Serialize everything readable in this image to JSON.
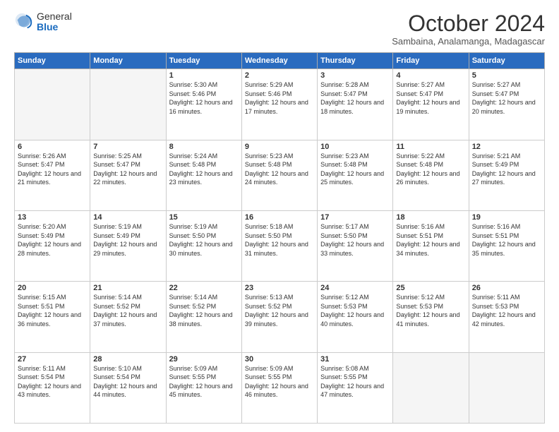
{
  "logo": {
    "general": "General",
    "blue": "Blue"
  },
  "header": {
    "title": "October 2024",
    "subtitle": "Sambaina, Analamanga, Madagascar"
  },
  "weekdays": [
    "Sunday",
    "Monday",
    "Tuesday",
    "Wednesday",
    "Thursday",
    "Friday",
    "Saturday"
  ],
  "days": [
    {
      "day": "",
      "sunrise": "",
      "sunset": "",
      "daylight": ""
    },
    {
      "day": "",
      "sunrise": "",
      "sunset": "",
      "daylight": ""
    },
    {
      "day": "1",
      "sunrise": "Sunrise: 5:30 AM",
      "sunset": "Sunset: 5:46 PM",
      "daylight": "Daylight: 12 hours and 16 minutes."
    },
    {
      "day": "2",
      "sunrise": "Sunrise: 5:29 AM",
      "sunset": "Sunset: 5:46 PM",
      "daylight": "Daylight: 12 hours and 17 minutes."
    },
    {
      "day": "3",
      "sunrise": "Sunrise: 5:28 AM",
      "sunset": "Sunset: 5:47 PM",
      "daylight": "Daylight: 12 hours and 18 minutes."
    },
    {
      "day": "4",
      "sunrise": "Sunrise: 5:27 AM",
      "sunset": "Sunset: 5:47 PM",
      "daylight": "Daylight: 12 hours and 19 minutes."
    },
    {
      "day": "5",
      "sunrise": "Sunrise: 5:27 AM",
      "sunset": "Sunset: 5:47 PM",
      "daylight": "Daylight: 12 hours and 20 minutes."
    },
    {
      "day": "6",
      "sunrise": "Sunrise: 5:26 AM",
      "sunset": "Sunset: 5:47 PM",
      "daylight": "Daylight: 12 hours and 21 minutes."
    },
    {
      "day": "7",
      "sunrise": "Sunrise: 5:25 AM",
      "sunset": "Sunset: 5:47 PM",
      "daylight": "Daylight: 12 hours and 22 minutes."
    },
    {
      "day": "8",
      "sunrise": "Sunrise: 5:24 AM",
      "sunset": "Sunset: 5:48 PM",
      "daylight": "Daylight: 12 hours and 23 minutes."
    },
    {
      "day": "9",
      "sunrise": "Sunrise: 5:23 AM",
      "sunset": "Sunset: 5:48 PM",
      "daylight": "Daylight: 12 hours and 24 minutes."
    },
    {
      "day": "10",
      "sunrise": "Sunrise: 5:23 AM",
      "sunset": "Sunset: 5:48 PM",
      "daylight": "Daylight: 12 hours and 25 minutes."
    },
    {
      "day": "11",
      "sunrise": "Sunrise: 5:22 AM",
      "sunset": "Sunset: 5:48 PM",
      "daylight": "Daylight: 12 hours and 26 minutes."
    },
    {
      "day": "12",
      "sunrise": "Sunrise: 5:21 AM",
      "sunset": "Sunset: 5:49 PM",
      "daylight": "Daylight: 12 hours and 27 minutes."
    },
    {
      "day": "13",
      "sunrise": "Sunrise: 5:20 AM",
      "sunset": "Sunset: 5:49 PM",
      "daylight": "Daylight: 12 hours and 28 minutes."
    },
    {
      "day": "14",
      "sunrise": "Sunrise: 5:19 AM",
      "sunset": "Sunset: 5:49 PM",
      "daylight": "Daylight: 12 hours and 29 minutes."
    },
    {
      "day": "15",
      "sunrise": "Sunrise: 5:19 AM",
      "sunset": "Sunset: 5:50 PM",
      "daylight": "Daylight: 12 hours and 30 minutes."
    },
    {
      "day": "16",
      "sunrise": "Sunrise: 5:18 AM",
      "sunset": "Sunset: 5:50 PM",
      "daylight": "Daylight: 12 hours and 31 minutes."
    },
    {
      "day": "17",
      "sunrise": "Sunrise: 5:17 AM",
      "sunset": "Sunset: 5:50 PM",
      "daylight": "Daylight: 12 hours and 33 minutes."
    },
    {
      "day": "18",
      "sunrise": "Sunrise: 5:16 AM",
      "sunset": "Sunset: 5:51 PM",
      "daylight": "Daylight: 12 hours and 34 minutes."
    },
    {
      "day": "19",
      "sunrise": "Sunrise: 5:16 AM",
      "sunset": "Sunset: 5:51 PM",
      "daylight": "Daylight: 12 hours and 35 minutes."
    },
    {
      "day": "20",
      "sunrise": "Sunrise: 5:15 AM",
      "sunset": "Sunset: 5:51 PM",
      "daylight": "Daylight: 12 hours and 36 minutes."
    },
    {
      "day": "21",
      "sunrise": "Sunrise: 5:14 AM",
      "sunset": "Sunset: 5:52 PM",
      "daylight": "Daylight: 12 hours and 37 minutes."
    },
    {
      "day": "22",
      "sunrise": "Sunrise: 5:14 AM",
      "sunset": "Sunset: 5:52 PM",
      "daylight": "Daylight: 12 hours and 38 minutes."
    },
    {
      "day": "23",
      "sunrise": "Sunrise: 5:13 AM",
      "sunset": "Sunset: 5:52 PM",
      "daylight": "Daylight: 12 hours and 39 minutes."
    },
    {
      "day": "24",
      "sunrise": "Sunrise: 5:12 AM",
      "sunset": "Sunset: 5:53 PM",
      "daylight": "Daylight: 12 hours and 40 minutes."
    },
    {
      "day": "25",
      "sunrise": "Sunrise: 5:12 AM",
      "sunset": "Sunset: 5:53 PM",
      "daylight": "Daylight: 12 hours and 41 minutes."
    },
    {
      "day": "26",
      "sunrise": "Sunrise: 5:11 AM",
      "sunset": "Sunset: 5:53 PM",
      "daylight": "Daylight: 12 hours and 42 minutes."
    },
    {
      "day": "27",
      "sunrise": "Sunrise: 5:11 AM",
      "sunset": "Sunset: 5:54 PM",
      "daylight": "Daylight: 12 hours and 43 minutes."
    },
    {
      "day": "28",
      "sunrise": "Sunrise: 5:10 AM",
      "sunset": "Sunset: 5:54 PM",
      "daylight": "Daylight: 12 hours and 44 minutes."
    },
    {
      "day": "29",
      "sunrise": "Sunrise: 5:09 AM",
      "sunset": "Sunset: 5:55 PM",
      "daylight": "Daylight: 12 hours and 45 minutes."
    },
    {
      "day": "30",
      "sunrise": "Sunrise: 5:09 AM",
      "sunset": "Sunset: 5:55 PM",
      "daylight": "Daylight: 12 hours and 46 minutes."
    },
    {
      "day": "31",
      "sunrise": "Sunrise: 5:08 AM",
      "sunset": "Sunset: 5:55 PM",
      "daylight": "Daylight: 12 hours and 47 minutes."
    },
    {
      "day": "",
      "sunrise": "",
      "sunset": "",
      "daylight": ""
    },
    {
      "day": "",
      "sunrise": "",
      "sunset": "",
      "daylight": ""
    }
  ]
}
